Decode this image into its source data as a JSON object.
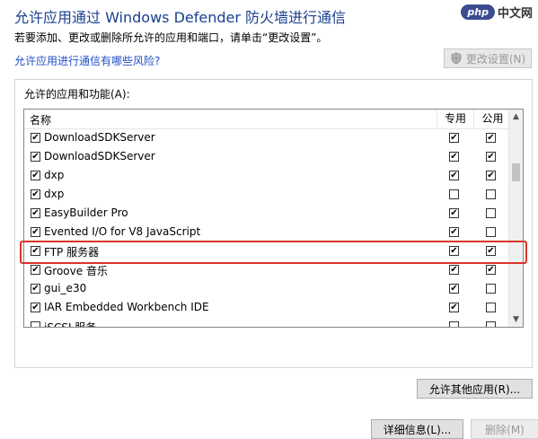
{
  "header": {
    "title": "允许应用通过 Windows Defender 防火墙进行通信",
    "subtitle": "若要添加、更改或删除所允许的应用和端口，请单击“更改设置”。",
    "risk_link": "允许应用进行通信有哪些风险?",
    "change_settings_label": "更改设置(N)"
  },
  "watermark": {
    "badge": "php",
    "text": "中文网"
  },
  "group": {
    "label": "允许的应用和功能(A):",
    "columns": {
      "name": "名称",
      "private": "专用",
      "public": "公用"
    },
    "rows": [
      {
        "name": "DownloadSDKServer",
        "enabled": true,
        "private": true,
        "public": true
      },
      {
        "name": "DownloadSDKServer",
        "enabled": true,
        "private": true,
        "public": true
      },
      {
        "name": "dxp",
        "enabled": true,
        "private": true,
        "public": true
      },
      {
        "name": "dxp",
        "enabled": true,
        "private": false,
        "public": false
      },
      {
        "name": "EasyBuilder Pro",
        "enabled": true,
        "private": true,
        "public": false
      },
      {
        "name": "Evented I/O for V8 JavaScript",
        "enabled": true,
        "private": true,
        "public": false
      },
      {
        "name": "FTP 服务器",
        "enabled": true,
        "private": true,
        "public": true
      },
      {
        "name": "Groove 音乐",
        "enabled": true,
        "private": true,
        "public": true
      },
      {
        "name": "gui_e30",
        "enabled": true,
        "private": true,
        "public": false
      },
      {
        "name": "IAR Embedded Workbench IDE",
        "enabled": true,
        "private": true,
        "public": false
      },
      {
        "name": "iSCSI 服务",
        "enabled": false,
        "private": false,
        "public": false
      }
    ],
    "highlighted_row": "FTP 服务器"
  },
  "buttons": {
    "details": "详细信息(L)...",
    "remove": "删除(M)",
    "allow_other": "允许其他应用(R)..."
  },
  "colors": {
    "title": "#1a3f8f",
    "link": "#1f4fc7",
    "highlight": "#d9342b"
  }
}
